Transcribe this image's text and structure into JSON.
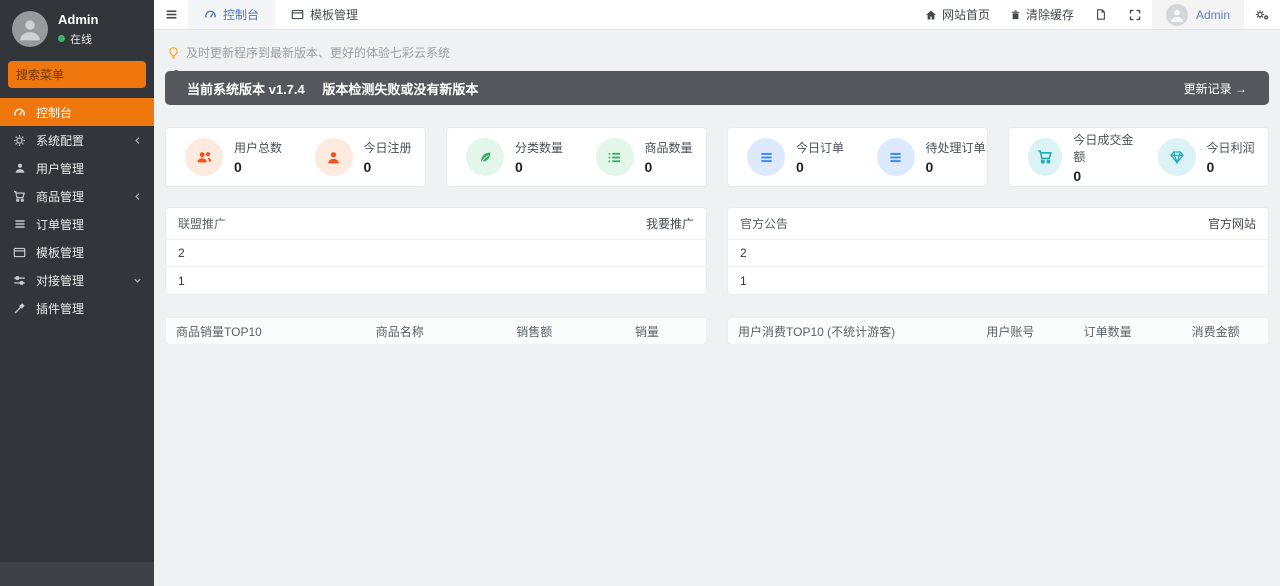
{
  "colors": {
    "accent_orange": "#f0760e",
    "sidebar_bg": "#32353a",
    "banner_bg": "#54575b",
    "active_tab_blue": "#4e73c2",
    "online_green": "#3cb36b",
    "stat_orange": "#f4511e",
    "stat_orange_bg": "#fdeade",
    "stat_green": "#2eaf5d",
    "stat_green_bg": "#e3f6ea",
    "stat_blue": "#3d8af8",
    "stat_blue_bg": "#ddeafd",
    "stat_teal": "#1cb0bd",
    "stat_teal_bg": "#dcf3f5"
  },
  "sidebar": {
    "user": {
      "name": "Admin",
      "status": "在线"
    },
    "search": {
      "placeholder": "搜索菜单",
      "icon": "search-icon"
    },
    "menu": [
      {
        "label": "控制台",
        "icon": "dashboard-icon",
        "active": true
      },
      {
        "label": "系统配置",
        "icon": "gear-icon",
        "chevron": "left"
      },
      {
        "label": "用户管理",
        "icon": "user-icon"
      },
      {
        "label": "商品管理",
        "icon": "cart-icon",
        "chevron": "left"
      },
      {
        "label": "订单管理",
        "icon": "list-icon"
      },
      {
        "label": "模板管理",
        "icon": "window-icon"
      },
      {
        "label": "对接管理",
        "icon": "sliders-icon",
        "chevron": "down"
      },
      {
        "label": "插件管理",
        "icon": "plugin-icon"
      }
    ]
  },
  "navbar": {
    "burger_icon": "hamburger-icon",
    "tabs": [
      {
        "label": "控制台",
        "icon": "dashboard-icon",
        "active": true
      },
      {
        "label": "模板管理",
        "icon": "window-icon",
        "active": false
      }
    ],
    "links": [
      {
        "label": "网站首页",
        "icon": "home-icon"
      },
      {
        "label": "清除缓存",
        "icon": "trash-icon"
      }
    ],
    "tool_icons": [
      "file-icon",
      "expand-icon"
    ],
    "user": {
      "name": "Admin"
    },
    "settings_icon": "gears-icon"
  },
  "content": {
    "tip": {
      "icon": "bulb-icon",
      "text": "及时更新程序到最新版本、更好的体验七彩云系统"
    },
    "version_banner": {
      "version": "当前系统版本 v1.7.4",
      "status": "版本检测失败或没有新版本",
      "link": "更新记录 →"
    },
    "stats": [
      {
        "items": [
          {
            "label": "用户总数",
            "value": "0",
            "icon": "users-icon"
          },
          {
            "label": "今日注册",
            "value": "0",
            "icon": "user-icon"
          }
        ]
      },
      {
        "items": [
          {
            "label": "分类数量",
            "value": "0",
            "icon": "leaf-icon"
          },
          {
            "label": "商品数量",
            "value": "0",
            "icon": "list-icon"
          }
        ]
      },
      {
        "items": [
          {
            "label": "今日订单",
            "value": "0",
            "icon": "bars-icon"
          },
          {
            "label": "待处理订单",
            "value": "0",
            "icon": "bars-icon"
          }
        ]
      },
      {
        "items": [
          {
            "label": "今日成交金额",
            "value": "0",
            "icon": "cart-icon"
          },
          {
            "label": "今日利润",
            "value": "0",
            "icon": "diamond-icon"
          }
        ]
      }
    ],
    "panels": [
      {
        "title": "联盟推广",
        "action": "我要推广",
        "rows": [
          "2",
          "1"
        ]
      },
      {
        "title": "官方公告",
        "action": "官方网站",
        "rows": [
          "2",
          "1"
        ]
      }
    ],
    "tables": [
      {
        "title": "商品销量TOP10",
        "columns": [
          "商品名称",
          "销售额",
          "销量"
        ]
      },
      {
        "title": "用户消费TOP10 (不统计游客)",
        "columns": [
          "用户账号",
          "订单数量",
          "消费金额"
        ]
      }
    ]
  }
}
